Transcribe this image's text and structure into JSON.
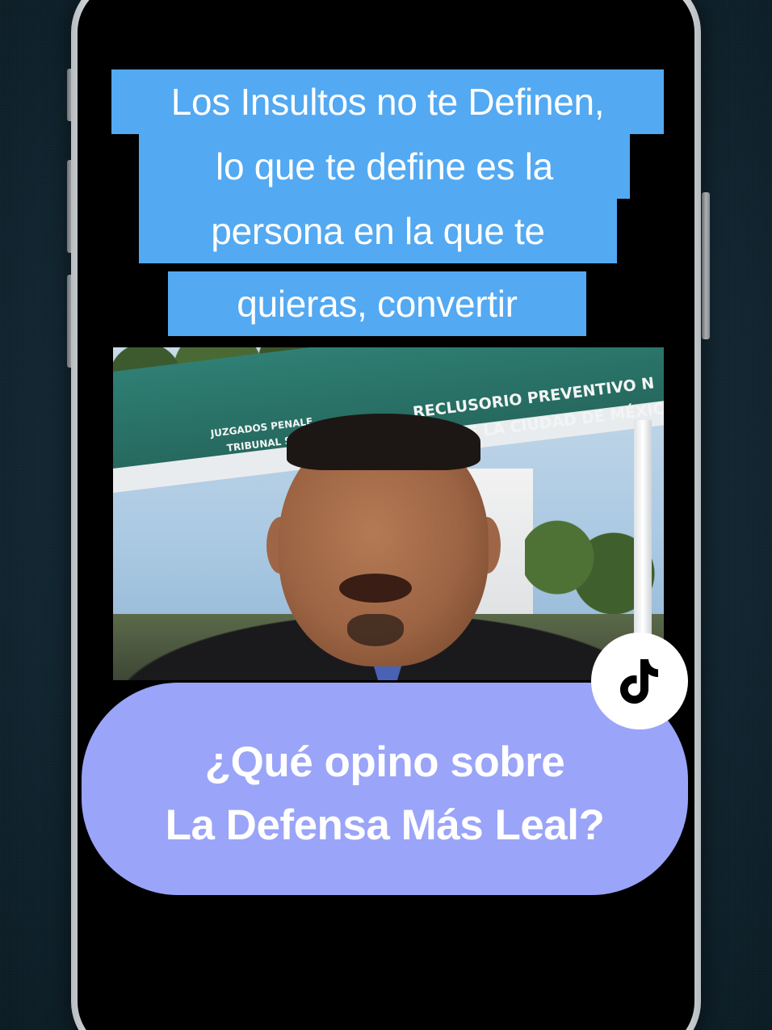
{
  "video_caption": {
    "lines": [
      "Los Insultos no te Definen,",
      "lo que te define es la",
      "persona en la que te",
      "quieras, convertir"
    ]
  },
  "video_scene": {
    "sign_line_1": "RECLUSORIO PREVENTIVO N",
    "sign_line_2": "CIA DE LA CIUDAD DE MÉXIC",
    "sign_small_1": "JUZGADOS PENALE",
    "sign_small_2": "TRIBUNAL SU"
  },
  "question_bubble": {
    "line_1": "¿Qué opino sobre",
    "line_2": "La Defensa Más Leal?",
    "background_color": "#9aa4f8"
  },
  "badge": {
    "icon": "tiktok-logo-icon"
  },
  "colors": {
    "caption_bg": "#53a9f2",
    "page_bg": "#152c38"
  }
}
